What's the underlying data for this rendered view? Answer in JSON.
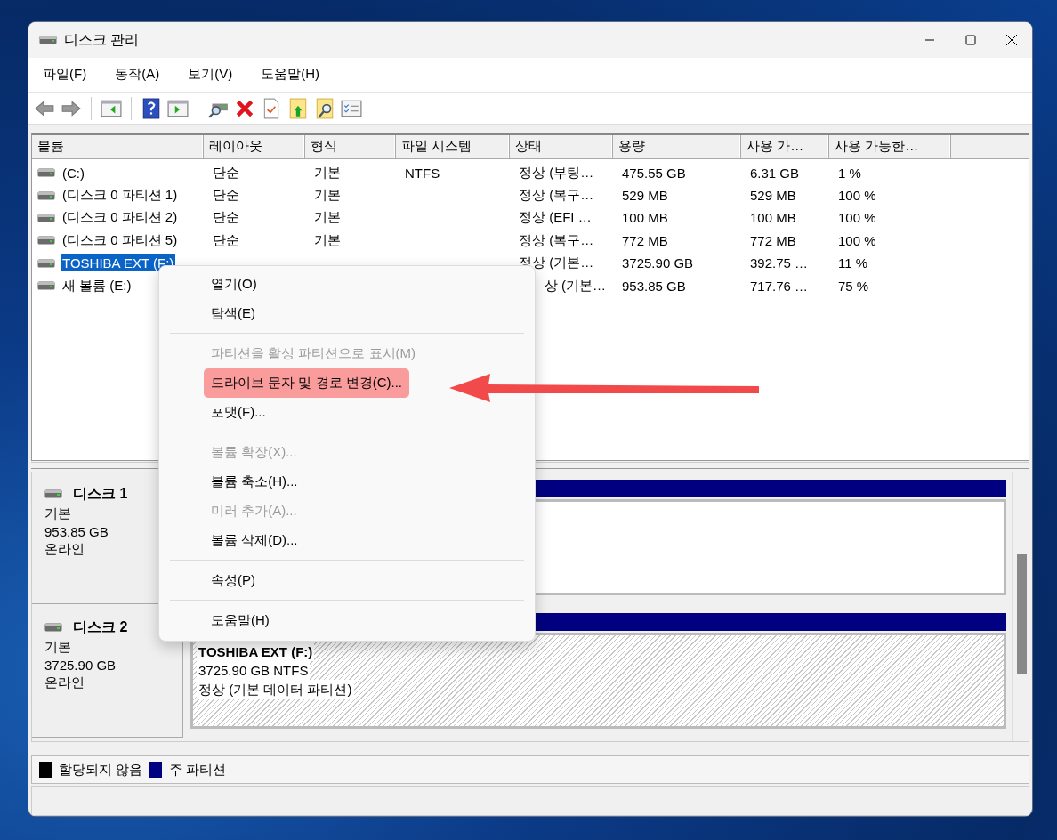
{
  "window": {
    "title": "디스크 관리"
  },
  "menu_bar": [
    "파일(F)",
    "동작(A)",
    "보기(V)",
    "도움말(H)"
  ],
  "volume_table": {
    "columns": [
      "볼륨",
      "레이아웃",
      "형식",
      "파일 시스템",
      "상태",
      "용량",
      "사용 가…",
      "사용 가능한…"
    ],
    "rows": [
      {
        "volume": "(C:)",
        "layout": "단순",
        "type": "기본",
        "file_system": "NTFS",
        "status": "정상 (부팅…",
        "capacity": "475.55 GB",
        "free_space": "6.31 GB",
        "percent_free": "1 %",
        "selected": false
      },
      {
        "volume": "(디스크 0 파티션 1)",
        "layout": "단순",
        "type": "기본",
        "status": "정상 (복구…",
        "capacity": "529 MB",
        "free_space": "529 MB",
        "percent_free": "100 %",
        "selected": false
      },
      {
        "volume": "(디스크 0 파티션 2)",
        "layout": "단순",
        "type": "기본",
        "status": "정상 (EFI …",
        "capacity": "100 MB",
        "free_space": "100 MB",
        "percent_free": "100 %",
        "selected": false
      },
      {
        "volume": "(디스크 0 파티션 5)",
        "layout": "단순",
        "type": "기본",
        "status": "정상 (복구…",
        "capacity": "772 MB",
        "free_space": "772 MB",
        "percent_free": "100 %",
        "selected": false
      },
      {
        "volume": "TOSHIBA EXT (F:)",
        "status": "정상 (기본…",
        "capacity": "3725.90 GB",
        "free_space": "392.75 …",
        "percent_free": "11 %",
        "selected": true
      },
      {
        "volume": "새 볼륨 (E:)",
        "status": "상 (기본…",
        "capacity": "953.85 GB",
        "free_space": "717.76 …",
        "percent_free": "75 %",
        "selected": false
      }
    ]
  },
  "disks": [
    {
      "name": "디스크 1",
      "type": "기본",
      "size": "953.85 GB",
      "status": "온라인",
      "partition": {
        "kind": "primary",
        "selected": false
      }
    },
    {
      "name": "디스크 2",
      "type": "기본",
      "size": "3725.90 GB",
      "status": "온라인",
      "partition": {
        "kind": "primary",
        "selected": true,
        "label": "TOSHIBA EXT  (F:)",
        "detail": "3725.90 GB NTFS",
        "status": "정상 (기본 데이터 파티션)"
      }
    }
  ],
  "legend": [
    {
      "label": "할당되지 않음",
      "color": "#000000"
    },
    {
      "label": "주 파티션",
      "color": "#000080"
    }
  ],
  "context_menu": {
    "items": [
      {
        "kind": "item",
        "label": "열기(O)",
        "disabled": false,
        "selected": false
      },
      {
        "kind": "item",
        "label": "탐색(E)",
        "disabled": false,
        "selected": false
      },
      {
        "kind": "separator"
      },
      {
        "kind": "item",
        "label": "파티션을 활성 파티션으로 표시(M)",
        "disabled": true,
        "selected": false
      },
      {
        "kind": "item",
        "label": "드라이브 문자 및 경로 변경(C)...",
        "disabled": false,
        "selected": true
      },
      {
        "kind": "item",
        "label": "포맷(F)...",
        "disabled": false,
        "selected": false
      },
      {
        "kind": "separator"
      },
      {
        "kind": "item",
        "label": "볼륨 확장(X)...",
        "disabled": true,
        "selected": false
      },
      {
        "kind": "item",
        "label": "볼륨 축소(H)...",
        "disabled": false,
        "selected": false
      },
      {
        "kind": "item",
        "label": "미러 추가(A)...",
        "disabled": true,
        "selected": false
      },
      {
        "kind": "item",
        "label": "볼륨 삭제(D)...",
        "disabled": false,
        "selected": false
      },
      {
        "kind": "separator"
      },
      {
        "kind": "item",
        "label": "속성(P)",
        "disabled": false,
        "selected": false
      },
      {
        "kind": "separator"
      },
      {
        "kind": "item",
        "label": "도움말(H)",
        "disabled": false,
        "selected": false
      }
    ]
  }
}
